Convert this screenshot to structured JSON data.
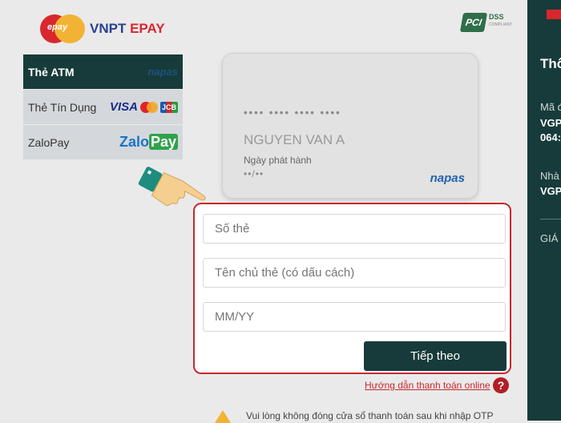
{
  "brand": {
    "logo_mark_text": "epay",
    "name_primary": "VNPT ",
    "name_accent": "EPAY"
  },
  "pci": {
    "mark": "PCI",
    "label": "DSS",
    "sub": "COMPLIANT"
  },
  "tabs": [
    {
      "label": "Thẻ ATM",
      "logo": "napas"
    },
    {
      "label": "Thẻ Tín Dụng",
      "logo_visa": "VISA",
      "logo_jcb": "JCB"
    },
    {
      "label": "ZaloPay",
      "logo_zalo": "Zalo",
      "logo_pay": "Pay"
    }
  ],
  "card_preview": {
    "number": "•••• •••• •••• ••••",
    "holder": "NGUYEN VAN A",
    "issue_label": "Ngày phát hành",
    "issue_date": "••/••",
    "network": "napas"
  },
  "form": {
    "card_number_placeholder": "Số thẻ",
    "holder_placeholder": "Tên chủ thẻ (có dấu cách)",
    "date_placeholder": "MM/YY",
    "submit_label": "Tiếp theo"
  },
  "help_link": "Hướng dẫn thanh toán online",
  "help_icon": "?",
  "warning": "Vui lòng không đóng cửa sổ thanh toán sau khi nhập OTP",
  "side_panel": {
    "heading": "Thô",
    "label_1": "Mã đ",
    "value_1a": "VGP",
    "value_1b": "064:",
    "label_2": "Nhà",
    "value_2": "VGP",
    "label_3": "GIÁ"
  },
  "colors": {
    "primary": "#173b3a",
    "accent": "#c8282e",
    "brand_blue": "#2a3f8f"
  },
  "icons": [
    "pointing-hand-icon",
    "question-icon",
    "warning-icon",
    "vietnam-flag-icon"
  ]
}
